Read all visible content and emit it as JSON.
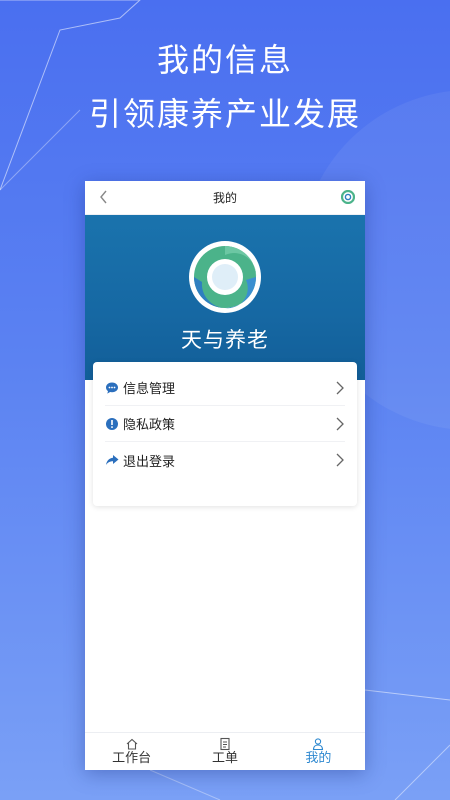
{
  "promo": {
    "line1": "我的信息",
    "line2": "引领康养产业发展"
  },
  "screen": {
    "nav_title": "我的",
    "brand_name": "天与养老",
    "menu": [
      {
        "label": "信息管理",
        "icon": "chat-bubble-icon"
      },
      {
        "label": "隐私政策",
        "icon": "info-alert-icon"
      },
      {
        "label": "退出登录",
        "icon": "share-arrow-icon"
      }
    ],
    "tabs": [
      {
        "label": "工作台",
        "icon": "home-icon",
        "active": false
      },
      {
        "label": "工单",
        "icon": "document-icon",
        "active": false
      },
      {
        "label": "我的",
        "icon": "user-icon",
        "active": true
      }
    ]
  },
  "colors": {
    "background_top": "#4a6ff0",
    "background_bottom": "#7aa0f6",
    "banner": "#1668a3",
    "accent": "#2f89d0",
    "logo_green": "#4bb38a",
    "logo_blue": "#2f7fc0"
  }
}
